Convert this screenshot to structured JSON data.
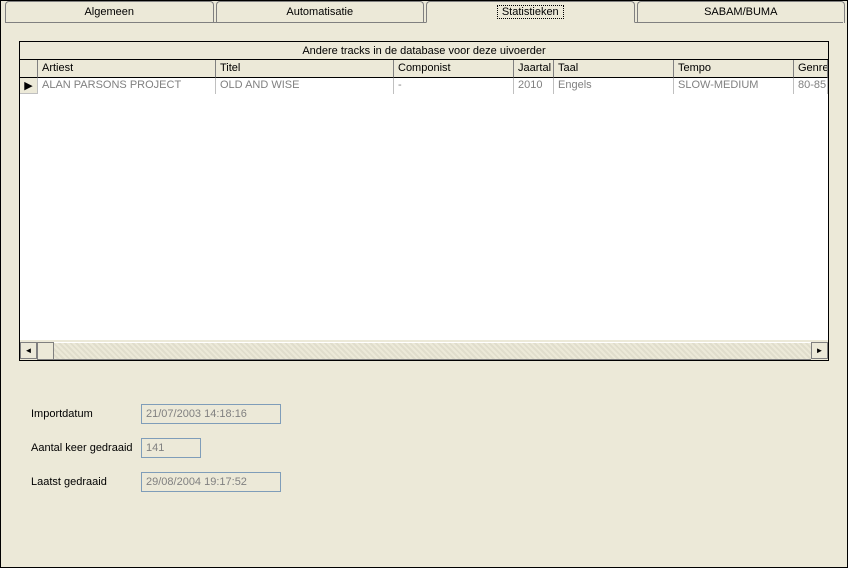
{
  "tabs": {
    "algemeen": "Algemeen",
    "automatisatie": "Automatisatie",
    "statistieken": "Statistieken",
    "sabam": "SABAM/BUMA"
  },
  "panel": {
    "title": "Andere tracks in de database voor deze uivoerder",
    "headers": {
      "artiest": "Artiest",
      "titel": "Titel",
      "componist": "Componist",
      "jaartal": "Jaartal",
      "taal": "Taal",
      "tempo": "Tempo",
      "genre": "Genre"
    },
    "rows": [
      {
        "artiest": "ALAN PARSONS PROJECT",
        "titel": "OLD AND WISE",
        "componist": "-",
        "jaartal": "2010",
        "taal": "Engels",
        "tempo": "SLOW-MEDIUM",
        "genre": "80-85"
      }
    ]
  },
  "form": {
    "importdatum_label": "Importdatum",
    "importdatum_value": "21/07/2003 14:18:16",
    "aantal_label": "Aantal keer gedraaid",
    "aantal_value": "141",
    "laatst_label": "Laatst gedraaid",
    "laatst_value": "29/08/2004 19:17:52"
  },
  "icons": {
    "row_marker": "▶",
    "scroll_left": "◄",
    "scroll_right": "►"
  }
}
